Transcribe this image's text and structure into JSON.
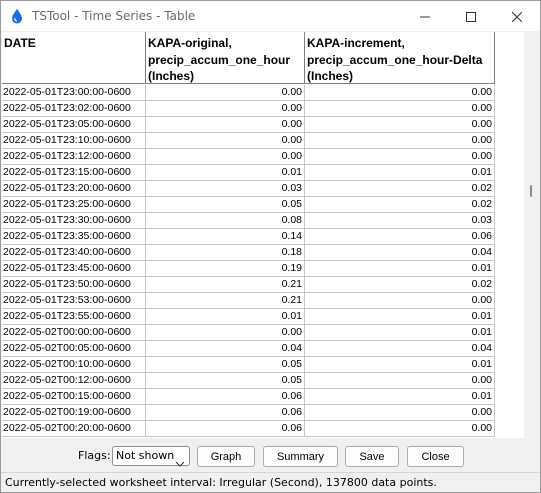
{
  "window": {
    "title": "TSTool - Time Series - Table",
    "controls": {
      "minimize": "minimize",
      "maximize": "maximize",
      "close": "close"
    }
  },
  "table": {
    "columns": [
      "DATE",
      "KAPA-original,\nprecip_accum_one_hour\n(Inches)",
      "KAPA-increment,\nprecip_accum_one_hour-Delta\n(Inches)"
    ],
    "rows": [
      [
        "2022-05-01T23:00:00-0600",
        "0.00",
        "0.00"
      ],
      [
        "2022-05-01T23:02:00-0600",
        "0.00",
        "0.00"
      ],
      [
        "2022-05-01T23:05:00-0600",
        "0.00",
        "0.00"
      ],
      [
        "2022-05-01T23:10:00-0600",
        "0.00",
        "0.00"
      ],
      [
        "2022-05-01T23:12:00-0600",
        "0.00",
        "0.00"
      ],
      [
        "2022-05-01T23:15:00-0600",
        "0.01",
        "0.01"
      ],
      [
        "2022-05-01T23:20:00-0600",
        "0.03",
        "0.02"
      ],
      [
        "2022-05-01T23:25:00-0600",
        "0.05",
        "0.02"
      ],
      [
        "2022-05-01T23:30:00-0600",
        "0.08",
        "0.03"
      ],
      [
        "2022-05-01T23:35:00-0600",
        "0.14",
        "0.06"
      ],
      [
        "2022-05-01T23:40:00-0600",
        "0.18",
        "0.04"
      ],
      [
        "2022-05-01T23:45:00-0600",
        "0.19",
        "0.01"
      ],
      [
        "2022-05-01T23:50:00-0600",
        "0.21",
        "0.02"
      ],
      [
        "2022-05-01T23:53:00-0600",
        "0.21",
        "0.00"
      ],
      [
        "2022-05-01T23:55:00-0600",
        "0.01",
        "0.01"
      ],
      [
        "2022-05-02T00:00:00-0600",
        "0.00",
        "0.01"
      ],
      [
        "2022-05-02T00:05:00-0600",
        "0.04",
        "0.04"
      ],
      [
        "2022-05-02T00:10:00-0600",
        "0.05",
        "0.01"
      ],
      [
        "2022-05-02T00:12:00-0600",
        "0.05",
        "0.00"
      ],
      [
        "2022-05-02T00:15:00-0600",
        "0.06",
        "0.01"
      ],
      [
        "2022-05-02T00:19:00-0600",
        "0.06",
        "0.00"
      ],
      [
        "2022-05-02T00:20:00-0600",
        "0.06",
        "0.00"
      ]
    ]
  },
  "bottom": {
    "flags_label": "Flags:",
    "flags_value": "Not shown",
    "graph_label": "Graph",
    "summary_label": "Summary",
    "save_label": "Save",
    "close_label": "Close"
  },
  "status": {
    "text": "Currently-selected worksheet interval: Irregular (Second), 137800 data points."
  },
  "colors": {
    "window_bg": "#f0f0f0",
    "titlebar_bg": "#ffffff",
    "grid_line": "#c6c6c6",
    "app_icon": "#1e6fd9"
  }
}
